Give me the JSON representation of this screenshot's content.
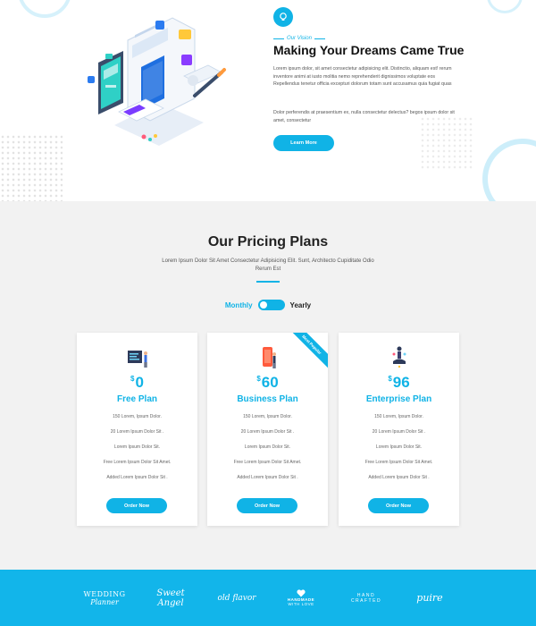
{
  "vision": {
    "eyebrow": "Our Vision",
    "title": "Making Your Dreams Came True",
    "paragraph1": "Lorem ipsum dolor, sit amet consectetur adipisicing elit. Distinctio, aliquam est! rerum inventore animi at iusto molitia nemo reprehenderit dignissimos voluptate eos Repellendus tenetur officia excepturi dolorum totam sunt accusamus quia fugiat quas",
    "paragraph2": "Dolor perferendis at praesentium ex, nulla consectetur delectus? begos ipsum dolor sit amet, consectetur",
    "button_label": "Learn More"
  },
  "pricing": {
    "title": "Our Pricing Plans",
    "subtitle": "Lorem Ipsum Dolor Sit Amet Consectetur Adipisicing Elit. Sunt, Architecto Cupiditate Odio Rerum Est",
    "toggle": {
      "left_label": "Monthly",
      "right_label": "Yearly",
      "selected": "Monthly"
    },
    "plans": [
      {
        "currency": "$",
        "price": "0",
        "name": "Free Plan",
        "ribbon": "",
        "features": [
          "150 Lorem, Ipsum Dolor.",
          "20 Lorem Ipsum Dolor Sit .",
          "Lorem Ipsum Dolor Sit.",
          "Free Lorem Ipsum Dolor Sit Amet.",
          "Added Lorem Ipsum Dolor Sit ."
        ],
        "button_label": "Order Now"
      },
      {
        "currency": "$",
        "price": "60",
        "name": "Business Plan",
        "ribbon": "Most Popular",
        "features": [
          "150 Lorem, Ipsum Dolor.",
          "20 Lorem Ipsum Dolor Sit .",
          "Lorem Ipsum Dolor Sit.",
          "Free Lorem Ipsum Dolor Sit Amet.",
          "Added Lorem Ipsum Dolor Sit ."
        ],
        "button_label": "Order Now"
      },
      {
        "currency": "$",
        "price": "96",
        "name": "Enterprise Plan",
        "ribbon": "",
        "features": [
          "150 Lorem, Ipsum Dolor.",
          "20 Lorem Ipsum Dolor Sit .",
          "Lorem Ipsum Dolor Sit.",
          "Free Lorem Ipsum Dolor Sit Amet.",
          "Added Lorem Ipsum Dolor Sit ."
        ],
        "button_label": "Order Now"
      }
    ]
  },
  "brands": [
    {
      "line1": "WEDDING",
      "line2": "Planner",
      "line3": ""
    },
    {
      "line1": "Sweet Angel",
      "line2": "",
      "line3": ""
    },
    {
      "line1": "old flavor",
      "line2": "",
      "line3": ""
    },
    {
      "line1": "HANDMADE",
      "line2": "WITH LOVE",
      "line3": ""
    },
    {
      "line1": "HAND",
      "line2": "CRAFTED",
      "line3": ""
    },
    {
      "line1": "puire",
      "line2": "",
      "line3": ""
    }
  ],
  "colors": {
    "accent": "#10b3e6",
    "brand_bar": "#12b5ea",
    "pricing_bg": "#f2f2f2"
  }
}
